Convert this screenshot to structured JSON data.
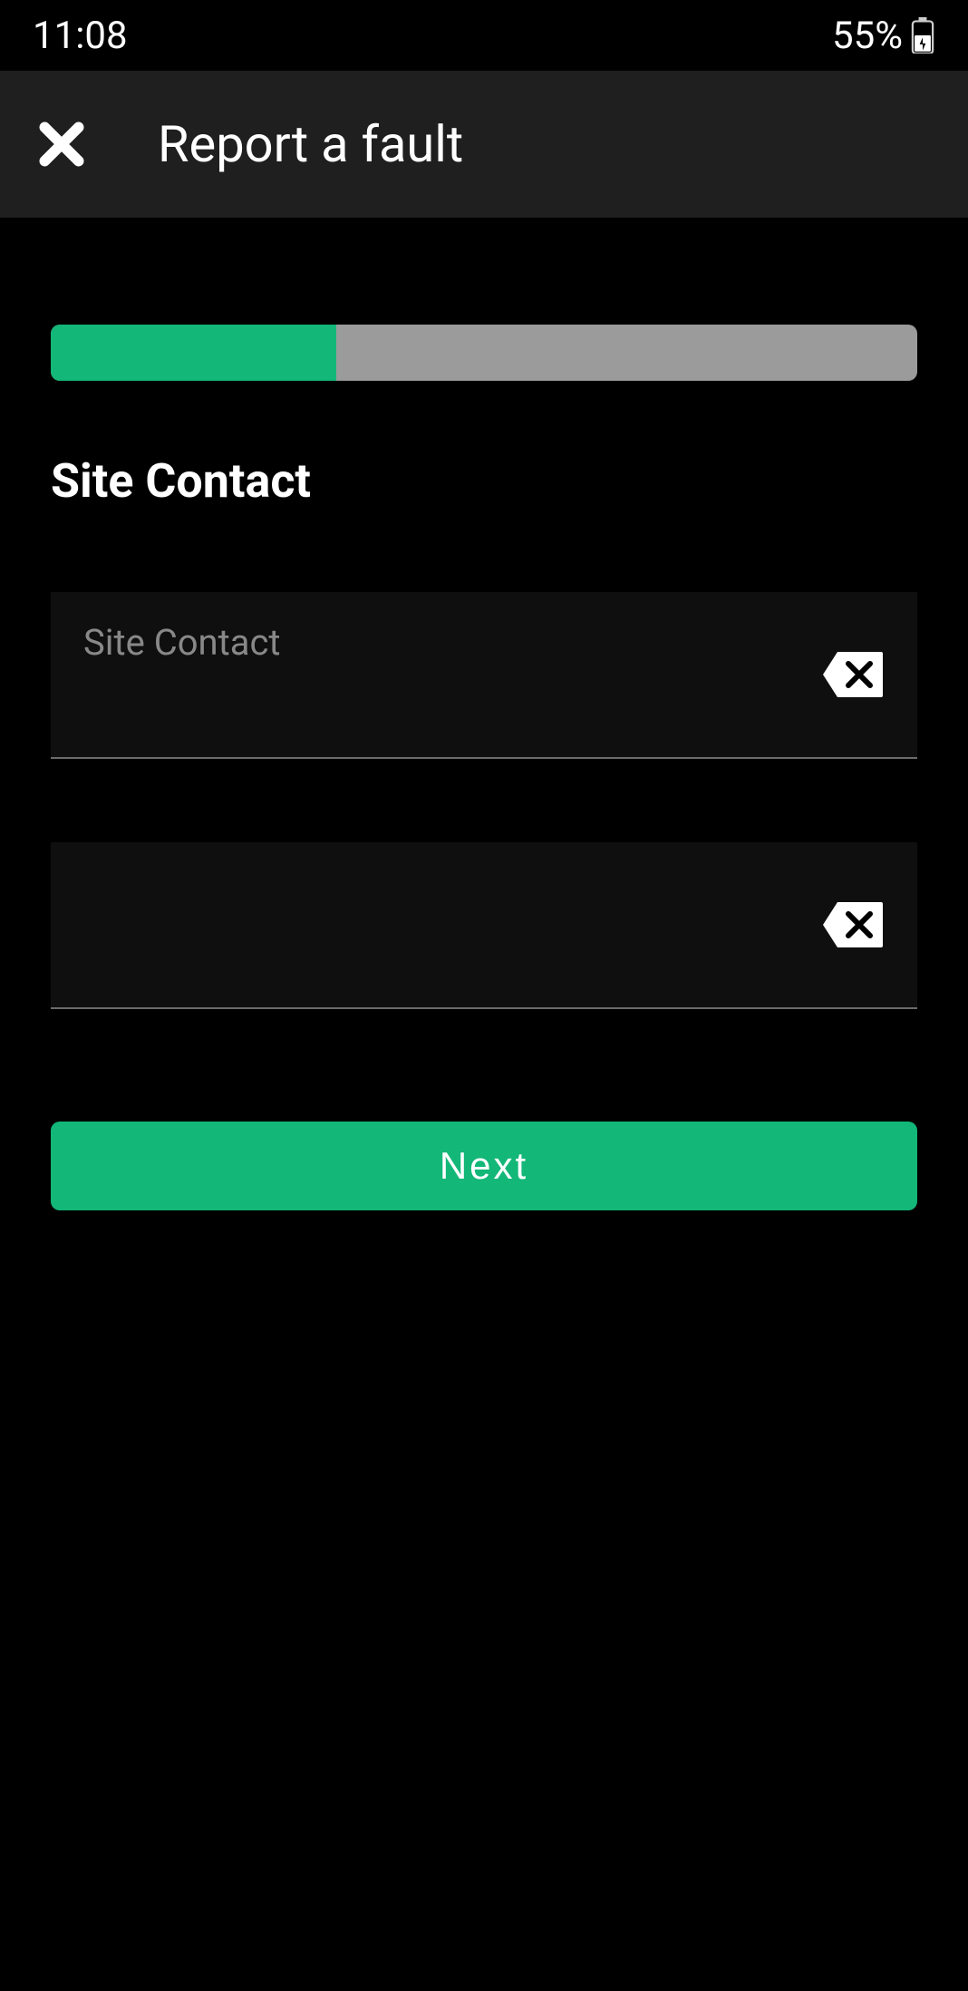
{
  "statusBar": {
    "time": "11:08",
    "batteryPercent": "55%"
  },
  "appBar": {
    "title": "Report a fault"
  },
  "progress": {
    "percent": 33
  },
  "section": {
    "title": "Site Contact"
  },
  "form": {
    "field1": {
      "label": "Site Contact",
      "value": ""
    },
    "field2": {
      "label": "",
      "value": ""
    }
  },
  "actions": {
    "next": "Next"
  },
  "colors": {
    "accent": "#13b778",
    "progressBg": "#9b9b9b"
  }
}
